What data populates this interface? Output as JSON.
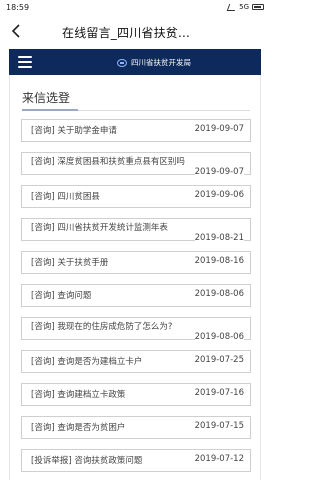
{
  "status": {
    "time": "18:59",
    "extra": "5G"
  },
  "header": {
    "title": "在线留言_四川省扶贫...",
    "site_name": "四川省扶贫开发局"
  },
  "section": {
    "title": "来信选登"
  },
  "items": [
    {
      "label": "[咨询] 关于助学金申请",
      "date": "2019-09-07",
      "wrap": false
    },
    {
      "label": "[咨询] 深度贫困县和扶贫重点县有区别吗",
      "date": "2019-09-07",
      "wrap": true
    },
    {
      "label": "[咨询] 四川贫困县",
      "date": "2019-09-06",
      "wrap": false
    },
    {
      "label": "[咨询] 四川省扶贫开发统计监测年表",
      "date": "2019-08-21",
      "wrap": true
    },
    {
      "label": "[咨询] 关于扶贫手册",
      "date": "2019-08-16",
      "wrap": false
    },
    {
      "label": "[咨询] 查询问题",
      "date": "2019-08-06",
      "wrap": false
    },
    {
      "label": "[咨询] 我现在的住房成危防了怎么为?",
      "date": "2019-08-06",
      "wrap": true
    },
    {
      "label": "[咨询] 查询是否为建档立卡户",
      "date": "2019-07-25",
      "wrap": false
    },
    {
      "label": "[咨询] 查询建档立卡政策",
      "date": "2019-07-16",
      "wrap": false
    },
    {
      "label": "[咨询] 查询是否为贫困户",
      "date": "2019-07-15",
      "wrap": false
    },
    {
      "label": "[投诉举报] 咨询扶贫政策问题",
      "date": "2019-07-12",
      "wrap": false
    }
  ]
}
